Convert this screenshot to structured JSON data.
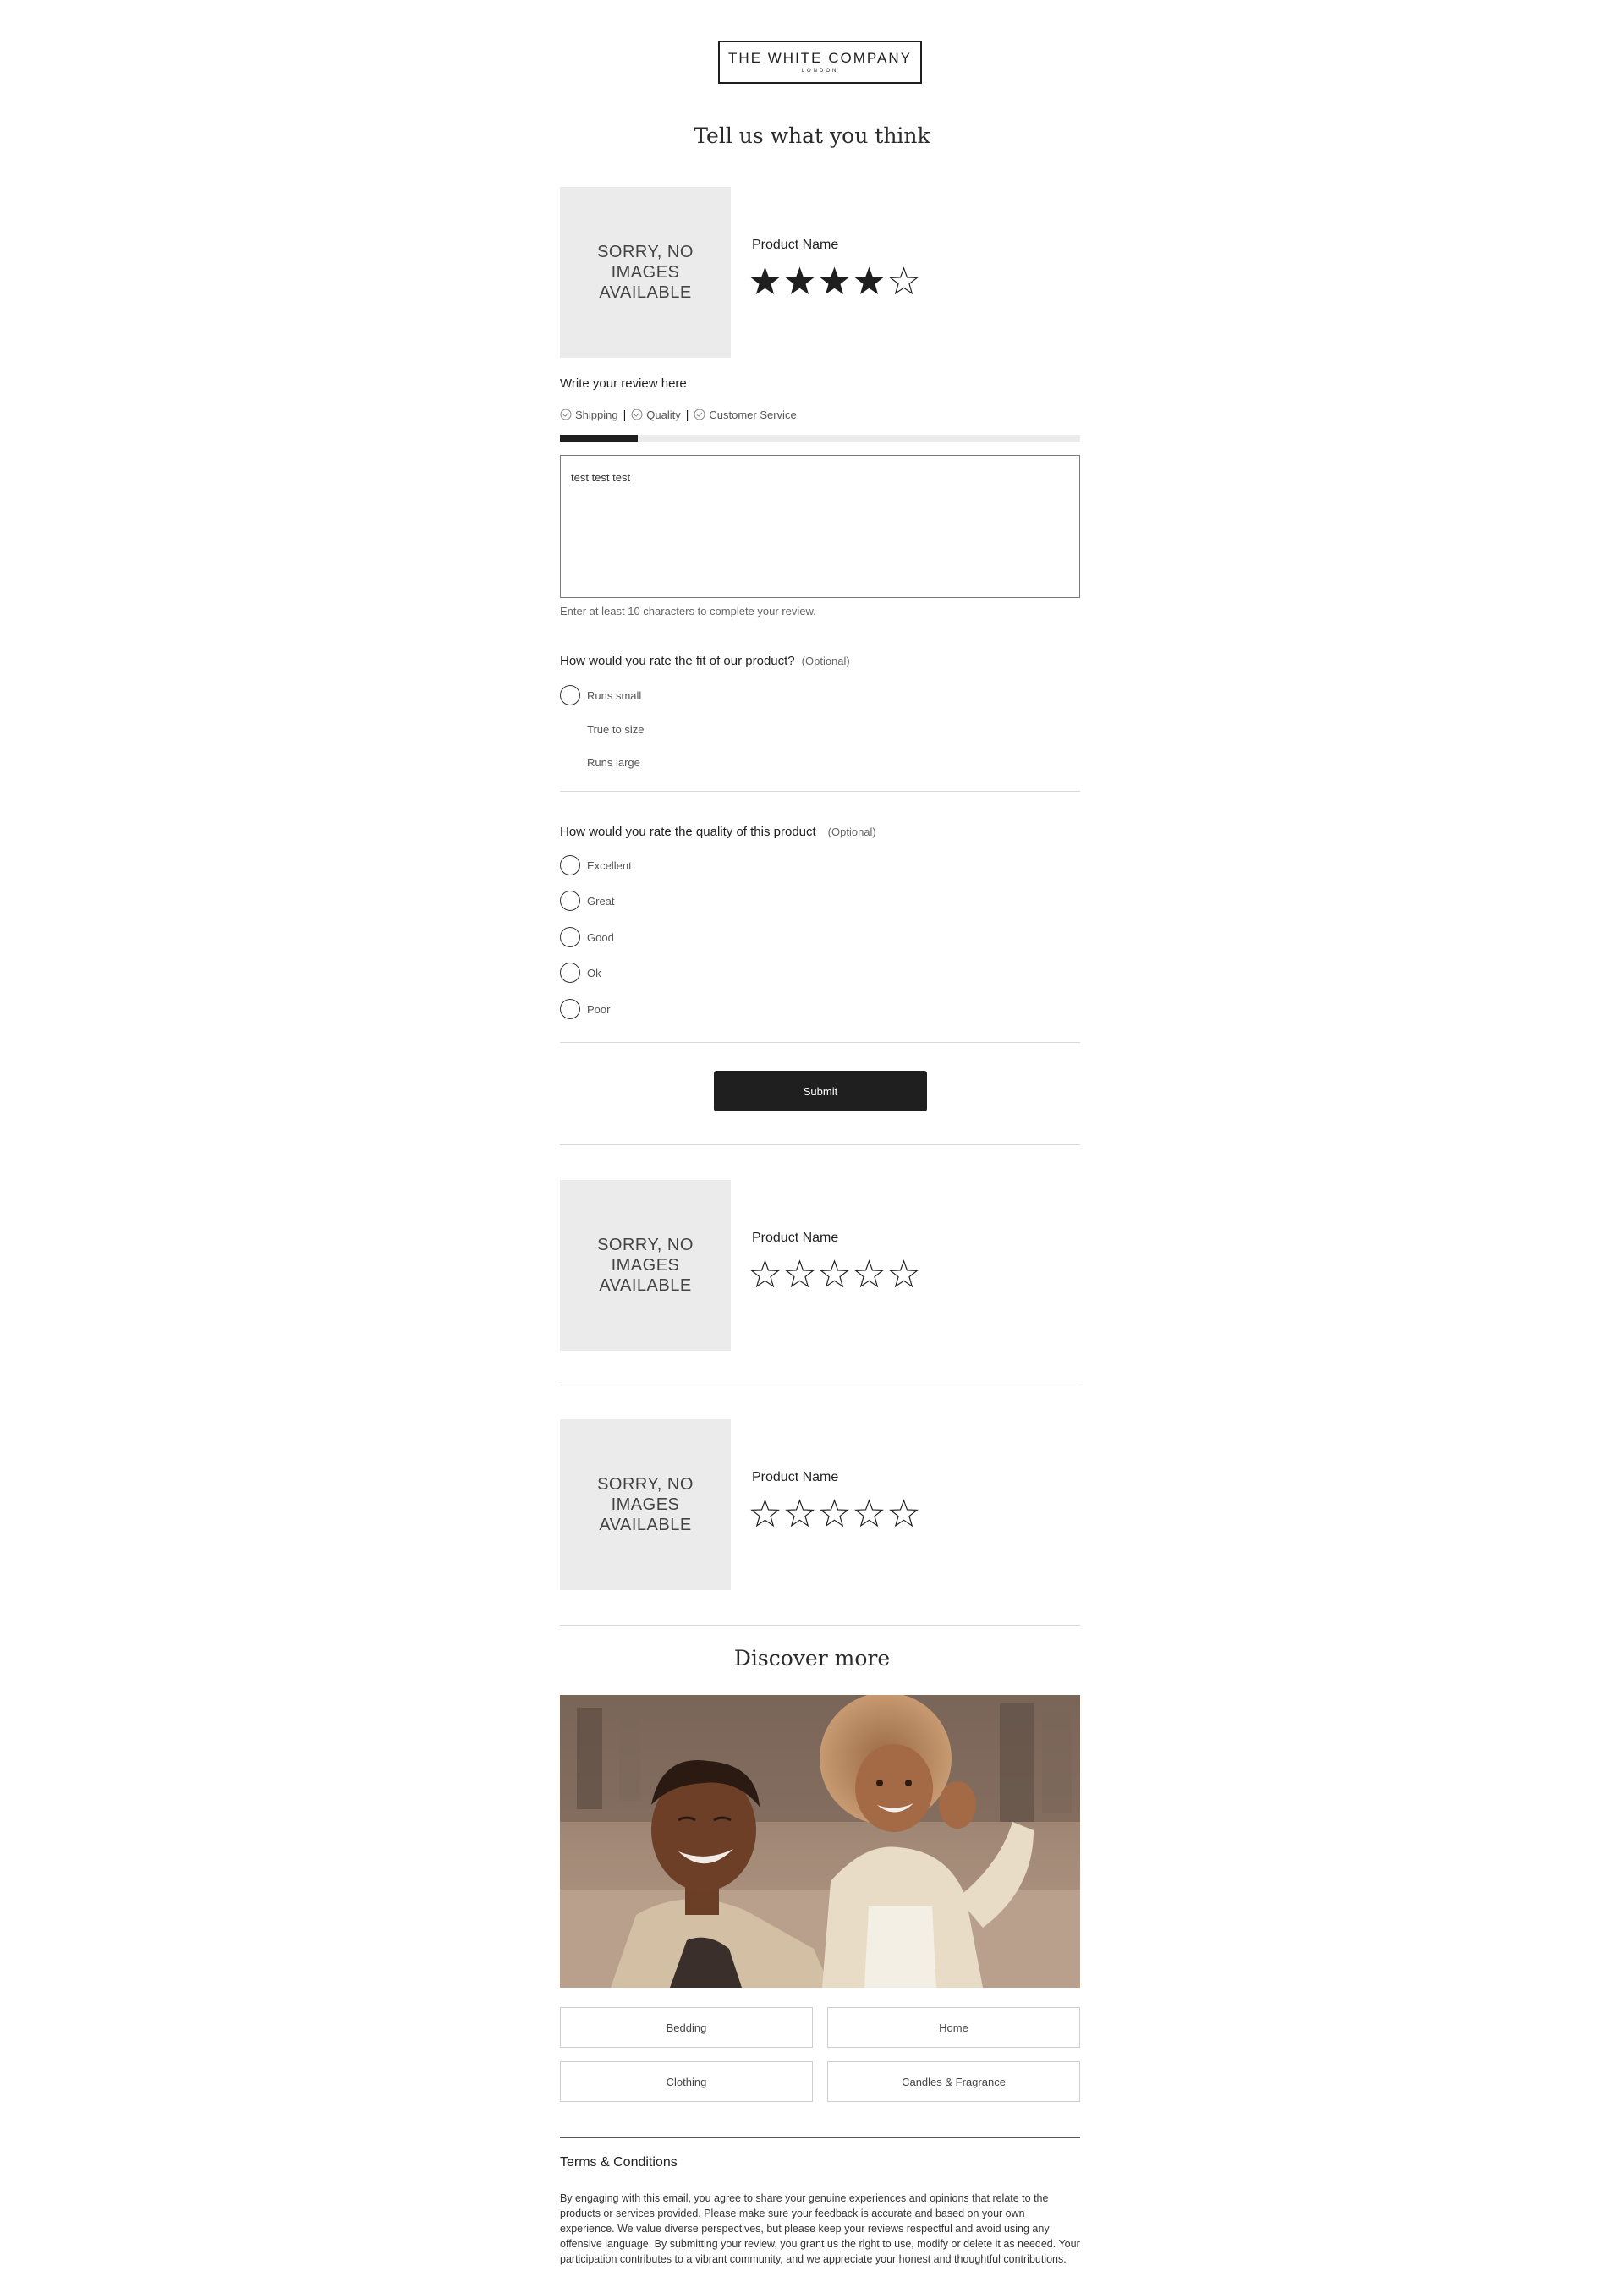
{
  "brand": {
    "logo_main": "THE WHITE COMPANY",
    "logo_sub": "LONDON"
  },
  "page_title": "Tell us what you think",
  "products": [
    {
      "image_placeholder": "SORRY, NO IMAGES AVAILABLE",
      "name": "Product Name",
      "rating": 4,
      "max_rating": 5
    },
    {
      "image_placeholder": "SORRY, NO IMAGES AVAILABLE",
      "name": "Product Name",
      "rating": 0,
      "max_rating": 5
    },
    {
      "image_placeholder": "SORRY, NO IMAGES AVAILABLE",
      "name": "Product Name",
      "rating": 0,
      "max_rating": 5
    }
  ],
  "review": {
    "label": "Write your review here",
    "tags": [
      "Shipping",
      "Quality",
      "Customer Service"
    ],
    "tag_separator": "|",
    "progress_fraction": 0.15,
    "value": "test test test",
    "hint": "Enter at least 10 characters to complete your review."
  },
  "fit_question": {
    "label": "How would you rate the fit of our product?",
    "optional": "(Optional)",
    "options": [
      "Runs small",
      "True to size",
      "Runs large"
    ]
  },
  "quality_question": {
    "label": "How would you rate the quality of this product",
    "optional": "(Optional)",
    "options": [
      "Excellent",
      "Great",
      "Good",
      "Ok",
      "Poor"
    ]
  },
  "submit_label": "Submit",
  "discover": {
    "title": "Discover more",
    "categories": [
      "Bedding",
      "Home",
      "Clothing",
      "Candles & Fragrance"
    ]
  },
  "terms": {
    "title": "Terms & Conditions",
    "body": "By engaging with this email, you agree to share your genuine experiences and opinions that relate to the products or services provided. Please make sure your feedback is accurate and based on your own experience. We value diverse perspectives, but please keep your reviews respectful and avoid using any offensive language. By submitting your review, you grant us the right to use, modify or delete it as needed. Your participation contributes to a vibrant community, and we appreciate your honest and thoughtful contributions."
  },
  "colors": {
    "primary": "#1f1f1f",
    "placeholder_bg": "#ebebeb",
    "divider": "#d9d9d9"
  }
}
